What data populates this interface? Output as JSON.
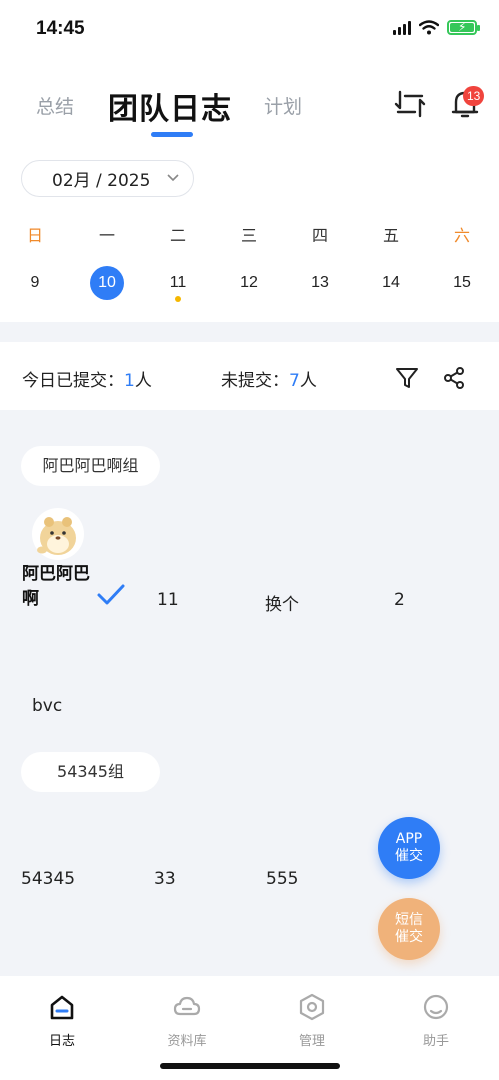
{
  "status_bar": {
    "time": "14:45"
  },
  "header": {
    "tabs": [
      {
        "label": "总结"
      },
      {
        "label": "团队日志"
      },
      {
        "label": "计划"
      }
    ],
    "notification_count": "13"
  },
  "date_picker": {
    "value": "02月 / 2025"
  },
  "week": {
    "weekdays": [
      "日",
      "一",
      "二",
      "三",
      "四",
      "五",
      "六"
    ],
    "days": [
      "9",
      "10",
      "11",
      "12",
      "13",
      "14",
      "15"
    ],
    "selected_day": "10",
    "marked_day": "11"
  },
  "summary": {
    "submitted_label": "今日已提交：",
    "submitted_count": "1",
    "submitted_unit": "人",
    "unsubmitted_label": "未提交：",
    "unsubmitted_count": "7",
    "unsubmitted_unit": "人"
  },
  "groups": [
    {
      "name": "阿巴阿巴啊组",
      "member": {
        "name_line1": "阿巴阿巴",
        "name_line2": "啊",
        "col1": "11",
        "col2": "换个",
        "col3": "2",
        "extra": "bvc"
      }
    },
    {
      "name": "54345组",
      "row": {
        "col0": "54345",
        "col1": "33",
        "col2": "555"
      }
    }
  ],
  "fab": {
    "app_line1": "APP",
    "app_line2": "催交",
    "sms_line1": "短信",
    "sms_line2": "催交"
  },
  "bottom_nav": [
    {
      "label": "日志"
    },
    {
      "label": "资料库"
    },
    {
      "label": "管理"
    },
    {
      "label": "助手"
    }
  ],
  "colors": {
    "accent": "#2f7df6",
    "weekend": "#f08a2b",
    "badge": "#f0443d",
    "sms_button": "#f0b27a"
  }
}
